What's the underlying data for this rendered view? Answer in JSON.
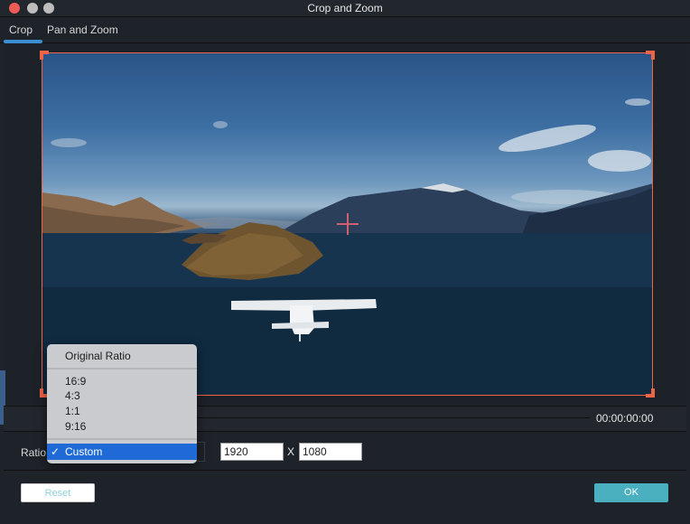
{
  "window": {
    "title": "Crop and Zoom",
    "traffic_lights": [
      "close",
      "minimize",
      "maximize"
    ]
  },
  "tabs": [
    {
      "label": "Crop",
      "active": true
    },
    {
      "label": "Pan and Zoom",
      "active": false
    }
  ],
  "preview": {
    "image_description": "Aerial view of a white seaplane flying over a lake with an island and mountains",
    "crop_frame_color": "#ef6347"
  },
  "timeline": {
    "timecode": "00:00:00:00"
  },
  "ratio": {
    "label": "Ratio",
    "selected": "Custom",
    "options_group1": [
      "Original Ratio"
    ],
    "options_group2": [
      "16:9",
      "4:3",
      "1:1",
      "9:16"
    ],
    "options_group3": [
      "Custom"
    ],
    "check_glyph": "✓",
    "width": "1920",
    "separator": "X",
    "height": "1080"
  },
  "buttons": {
    "reset": "Reset",
    "ok": "OK"
  },
  "colors": {
    "accent": "#3c8ed3",
    "ok_button": "#4ab0bf",
    "menu_highlight": "#1f6ad6"
  }
}
